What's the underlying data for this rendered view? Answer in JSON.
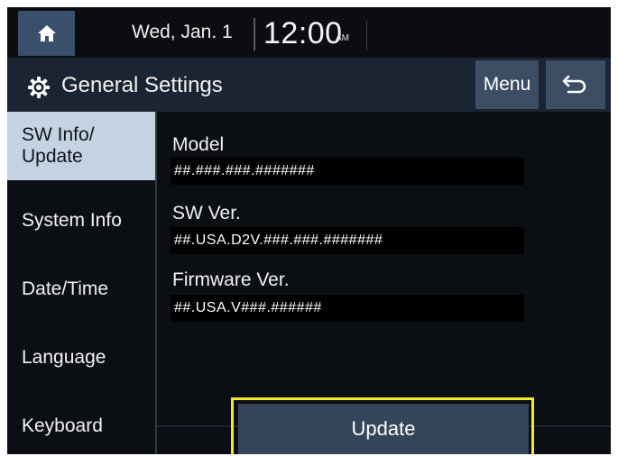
{
  "status_bar": {
    "home_icon": "home-icon",
    "date": "Wed, Jan. 1",
    "time": "12:00",
    "ampm": "AM"
  },
  "title_bar": {
    "gear_icon": "gear-icon",
    "title": "General Settings",
    "menu_label": "Menu",
    "back_icon": "back-arrow-icon"
  },
  "sidebar": {
    "items": [
      {
        "label": "SW Info/\nUpdate",
        "active": true
      },
      {
        "label": "System Info",
        "active": false
      },
      {
        "label": "Date/Time",
        "active": false
      },
      {
        "label": "Language",
        "active": false
      },
      {
        "label": "Keyboard",
        "active": false
      }
    ]
  },
  "main": {
    "fields": [
      {
        "label": "Model",
        "value": "##.###.###.#######"
      },
      {
        "label": "SW Ver.",
        "value": "##.USA.D2V.###.###.#######"
      },
      {
        "label": "Firmware Ver.",
        "value": "##.USA.V###.######"
      }
    ],
    "update_label": "Update"
  },
  "colors": {
    "highlight": "#f2ea2a",
    "button": "#3d4d64",
    "active_tab": "#c5d2e2"
  }
}
